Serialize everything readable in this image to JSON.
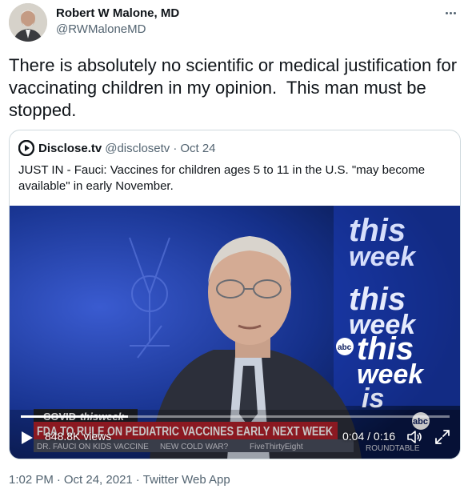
{
  "author": {
    "name": "Robert W Malone, MD",
    "handle": "@RWMaloneMD"
  },
  "tweet": {
    "text": "There is absolutely no scientific or medical justification for vaccinating children in my opinion.  This man must be stopped."
  },
  "quoted": {
    "name": "Disclose.tv",
    "handle": "@disclosetv",
    "separator": "·",
    "date": "Oct 24",
    "text": "JUST IN - Fauci: Vaccines for children ages 5 to 11 in the U.S. \"may become available\" in early November."
  },
  "video": {
    "views": "848.8K views",
    "time": "0:04 / 0:16",
    "progress_fraction": 0.25,
    "show_logo_word_1": "this",
    "show_logo_word_2": "week",
    "network": "abc",
    "chyron_tag": "COVID",
    "chyron_headline": "FDA TO RULE ON PEDIATRIC VACCINES EARLY NEXT WEEK",
    "chyron_sub": "DR. FAUCI ON KIDS VACCINE",
    "ticker_left": "NEW COLD WAR?",
    "ticker_mid": "FiveThirtyEight",
    "ticker_right": "ROUNDTABLE"
  },
  "footer": {
    "time": "1:02 PM",
    "date": "Oct 24, 2021",
    "source": "Twitter Web App",
    "separator": "·"
  },
  "colors": {
    "text_primary": "#0f1419",
    "text_secondary": "#536471",
    "border": "#cfd9de",
    "chyron_red": "#b3202b",
    "studio_blue": "#0c1d5e"
  },
  "icons": [
    "more-icon",
    "disclose-logo-icon",
    "play-icon",
    "volume-icon",
    "fullscreen-icon"
  ]
}
